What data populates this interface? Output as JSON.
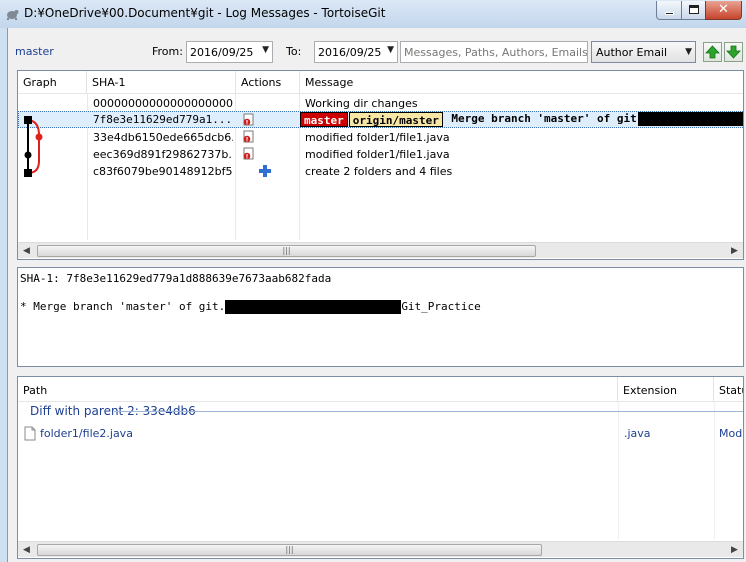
{
  "window": {
    "title": "D:¥OneDrive¥00.Document¥git - Log Messages - TortoiseGit"
  },
  "toolbar": {
    "branch": "master",
    "from_label": "From:",
    "from_date": "2016/09/25",
    "to_label": "To:",
    "to_date": "2016/09/25",
    "search_placeholder": "Messages, Paths, Authors, Emails, SHA",
    "filter_field": "Author Email"
  },
  "log": {
    "columns": [
      "Graph",
      "SHA-1",
      "Actions",
      "Message"
    ],
    "rows": [
      {
        "sha": "0000000000000000000000...",
        "message": "Working dir changes"
      },
      {
        "sha": "7f8e3e11629ed779a1...",
        "refs": [
          "master",
          "origin/master"
        ],
        "message": "Merge branch 'master' of git"
      },
      {
        "sha": "33e4db6150ede665dcb6...",
        "message": "modified folder1/file1.java"
      },
      {
        "sha": "eec369d891f29862737b...",
        "message": "modified folder1/file1.java"
      },
      {
        "sha": "c83f6079be90148912bf5...",
        "message": "create 2 folders and 4 files"
      }
    ]
  },
  "detail": {
    "sha_line": "SHA-1: 7f8e3e11629ed779a1d888639e7673aab682fada",
    "message_prefix": "* Merge branch 'master' of git.",
    "message_suffix": "Git_Practice"
  },
  "files": {
    "columns": [
      "Path",
      "Extension",
      "Status"
    ],
    "group_label": "Diff with parent 2: 33e4db6",
    "rows": [
      {
        "path": "folder1/file2.java",
        "extension": ".java",
        "status": "Modified"
      }
    ]
  },
  "colors": {
    "ref_local": "#cc0000",
    "ref_remote": "#f9e7a6",
    "link": "#1d3f91",
    "selection": "#dfeefc"
  }
}
